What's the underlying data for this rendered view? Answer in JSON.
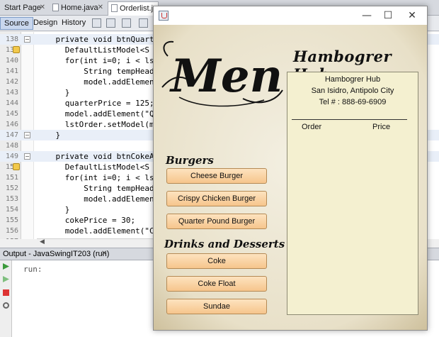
{
  "ide": {
    "tabs": [
      {
        "label": "Start Page"
      },
      {
        "label": "Home.java"
      },
      {
        "label": "Orderlist.java"
      }
    ],
    "toolbar": {
      "source_label": "Source",
      "design_label": "Design",
      "history_label": "History"
    },
    "code_lines": [
      {
        "num": "138",
        "code": "    private void btnQuarte"
      },
      {
        "num": "139",
        "code": "      DefaultListModel<S"
      },
      {
        "num": "140",
        "code": "      for(int i=0; i < ls"
      },
      {
        "num": "141",
        "code": "          String tempHead"
      },
      {
        "num": "142",
        "code": "          model.addElemen"
      },
      {
        "num": "143",
        "code": "      }"
      },
      {
        "num": "144",
        "code": "      quarterPrice = 125;"
      },
      {
        "num": "145",
        "code": "      model.addElement(\"Q"
      },
      {
        "num": "146",
        "code": "      lstOrder.setModel(m"
      },
      {
        "num": "147",
        "code": "    }"
      },
      {
        "num": "148",
        "code": ""
      },
      {
        "num": "149",
        "code": "    private void btnCokeAc"
      },
      {
        "num": "150",
        "code": "      DefaultListModel<S"
      },
      {
        "num": "151",
        "code": "      for(int i=0; i < ls"
      },
      {
        "num": "152",
        "code": "          String tempHead"
      },
      {
        "num": "153",
        "code": "          model.addElemen"
      },
      {
        "num": "154",
        "code": "      }"
      },
      {
        "num": "155",
        "code": "      cokePrice = 30;"
      },
      {
        "num": "156",
        "code": "      model.addElement(\"C"
      },
      {
        "num": "157",
        "code": "      lstOrder.setModel(m"
      }
    ],
    "output": {
      "title": "Output - JavaSwingIT203 (run)",
      "text": "run:"
    }
  },
  "app": {
    "logo_text": "Menu",
    "title": "Hambogrer Hub",
    "sections": {
      "burgers": "Burgers",
      "drinks": "Drinks and Desserts"
    },
    "burger_buttons": [
      "Cheese Burger",
      "Crispy Chicken Burger",
      "Quarter Pound Burger"
    ],
    "drink_buttons": [
      "Coke",
      "Coke Float",
      "Sundae"
    ],
    "receipt": {
      "name": "Hambogrer Hub",
      "address": "San Isidro, Antipolo City",
      "tel": "Tel # : 888-69-6909",
      "col_order": "Order",
      "col_price": "Price"
    }
  },
  "colors": {
    "button_top": "#fde3bf",
    "button_bottom": "#f6c58c",
    "receipt_bg": "#f4f0d0",
    "paper_bg": "#ece6d4",
    "keyword": "#0000e6",
    "field": "#009900"
  }
}
